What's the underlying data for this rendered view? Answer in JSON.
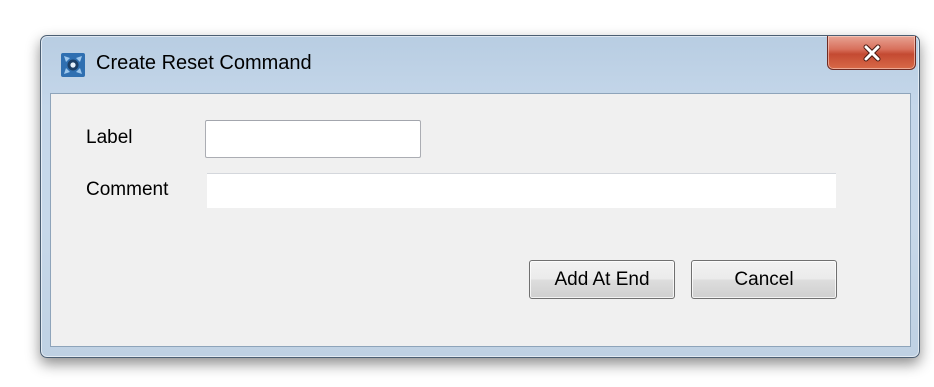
{
  "window": {
    "title": "Create Reset Command",
    "app_icon": "app-logo-icon",
    "close_icon": "close-icon"
  },
  "form": {
    "label_label": "Label",
    "label_value": "",
    "comment_label": "Comment",
    "comment_value": ""
  },
  "buttons": {
    "add_at_end": "Add At End",
    "cancel": "Cancel"
  },
  "colors": {
    "close_button": "#c94d36",
    "frame": "#c4d6e9",
    "client_background": "#f0f0f0"
  }
}
